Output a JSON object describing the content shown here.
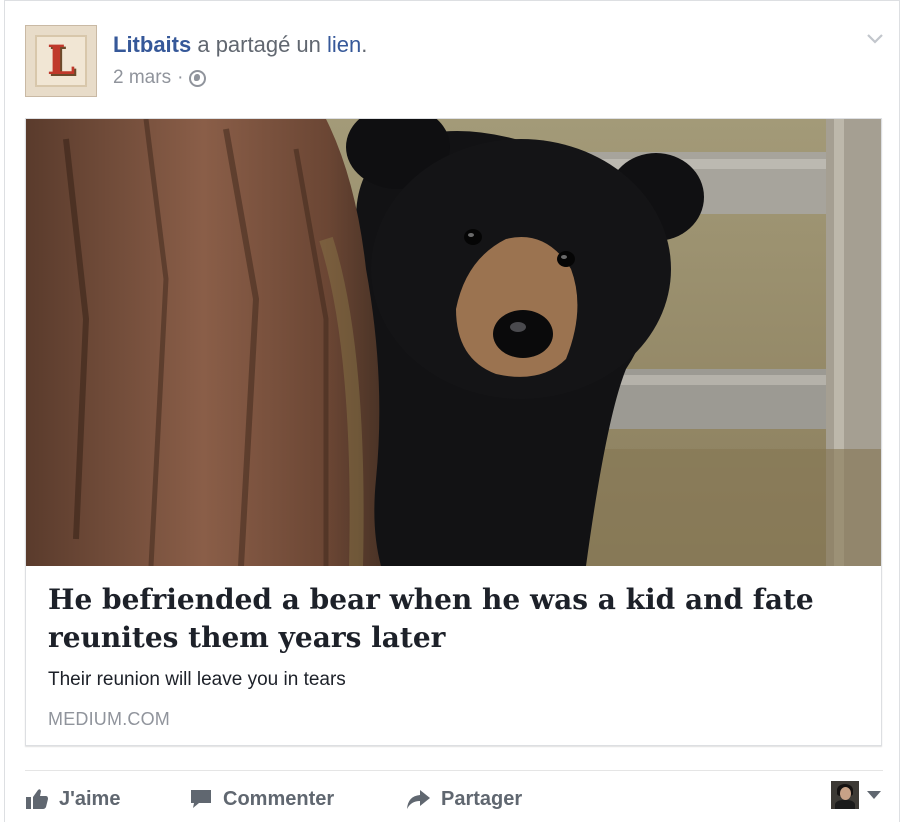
{
  "post": {
    "author": "Litbaits",
    "action_prefix": " a partagé un ",
    "action_link": "lien",
    "action_suffix": ".",
    "date": "2 mars",
    "separator": "·",
    "privacy_icon": "globe-icon",
    "avatar_letter": "L",
    "menu_icon": "chevron-down-icon"
  },
  "link_card": {
    "image_subject": "black-bear-cub-beside-tree",
    "title": "He befriended a bear when he was a kid and fate reunites them years later",
    "description": "Their reunion will leave you in tears",
    "domain": "MEDIUM.COM"
  },
  "actions": {
    "like_label": "J'aime",
    "comment_label": "Commenter",
    "share_label": "Partager",
    "like_icon": "thumbs-up-icon",
    "comment_icon": "comment-icon",
    "share_icon": "share-arrow-icon",
    "viewer_menu_icon": "caret-down-icon"
  },
  "colors": {
    "link_blue": "#365899",
    "meta_gray": "#90949c",
    "action_gray": "#606770",
    "text": "#1d2129",
    "logo_red": "#c0392b"
  }
}
